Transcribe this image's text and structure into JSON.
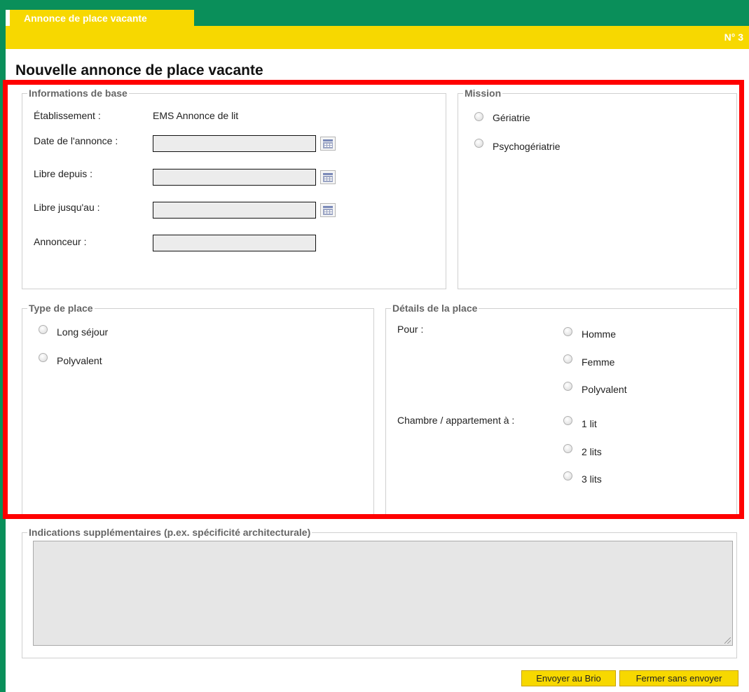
{
  "header": {
    "tab_label": "Annonce de place vacante",
    "page_number": "N° 3"
  },
  "page_title": "Nouvelle annonce de place vacante",
  "informations_de_base": {
    "legend": "Informations de base",
    "etablissement_label": "Établissement :",
    "etablissement_value": "EMS Annonce de lit",
    "date_annonce_label": "Date de l'annonce :",
    "libre_depuis_label": "Libre depuis :",
    "libre_jusquau_label": "Libre jusqu'au :",
    "annonceur_label": "Annonceur :"
  },
  "mission": {
    "legend": "Mission",
    "options": [
      "Gériatrie",
      "Psychogériatrie"
    ]
  },
  "type_de_place": {
    "legend": "Type de place",
    "options": [
      "Long séjour",
      "Polyvalent"
    ]
  },
  "details_de_la_place": {
    "legend": "Détails de la place",
    "pour_label": "Pour :",
    "pour_options": [
      "Homme",
      "Femme",
      "Polyvalent"
    ],
    "chambre_label": "Chambre / appartement à :",
    "chambre_options": [
      "1 lit",
      "2 lits",
      "3 lits"
    ]
  },
  "indications": {
    "legend": "Indications supplémentaires (p.ex. spécificité architecturale)"
  },
  "buttons": {
    "send": "Envoyer au Brio",
    "close": "Fermer sans envoyer"
  },
  "colors": {
    "green": "#0a8f5a",
    "yellow": "#f7d800",
    "highlight": "#ff0000"
  }
}
